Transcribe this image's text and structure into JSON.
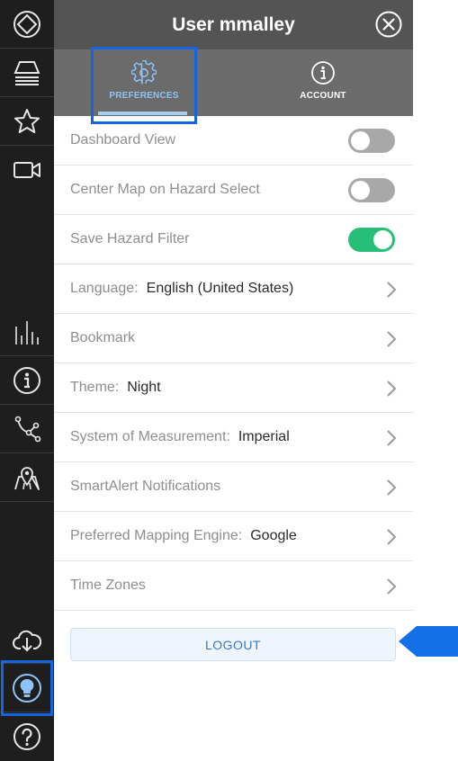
{
  "header": {
    "title": "User mmalley"
  },
  "tabs": [
    {
      "label": "PREFERENCES",
      "icon": "gear-icon",
      "active": true
    },
    {
      "label": "ACCOUNT",
      "icon": "info-icon",
      "active": false
    }
  ],
  "rows": [
    {
      "label": "Dashboard View",
      "control": "toggle",
      "on": false
    },
    {
      "label": "Center Map on Hazard Select",
      "control": "toggle",
      "on": false
    },
    {
      "label": "Save Hazard Filter",
      "control": "toggle",
      "on": true
    },
    {
      "label": "Language:",
      "value": "English (United States)",
      "control": "chevron"
    },
    {
      "label": "Bookmark",
      "value": "",
      "control": "chevron"
    },
    {
      "label": "Theme:",
      "value": "Night",
      "control": "chevron"
    },
    {
      "label": "System of Measurement:",
      "value": "Imperial",
      "control": "chevron"
    },
    {
      "label": "SmartAlert Notifications",
      "value": "",
      "control": "chevron"
    },
    {
      "label": "Preferred Mapping Engine:",
      "value": "Google",
      "control": "chevron"
    },
    {
      "label": "Time Zones",
      "value": "",
      "control": "chevron"
    }
  ],
  "logout": {
    "label": "LOGOUT"
  },
  "rail_icons": [
    "diamond-logo-icon",
    "layers-icon",
    "star-icon",
    "video-camera-icon",
    "bar-chart-icon",
    "info-icon",
    "route-icon",
    "map-pin-icon",
    "cloud-download-icon",
    "lightbulb-icon",
    "help-icon"
  ],
  "colors": {
    "rail_bg": "#1e1e1e",
    "header_bg": "#545454",
    "tabs_bg": "#6b6b6b",
    "toggle_on": "#25bf78",
    "toggle_off": "#a8a8a8",
    "highlight": "#1565e0",
    "active_tab": "#8fc3f5"
  }
}
